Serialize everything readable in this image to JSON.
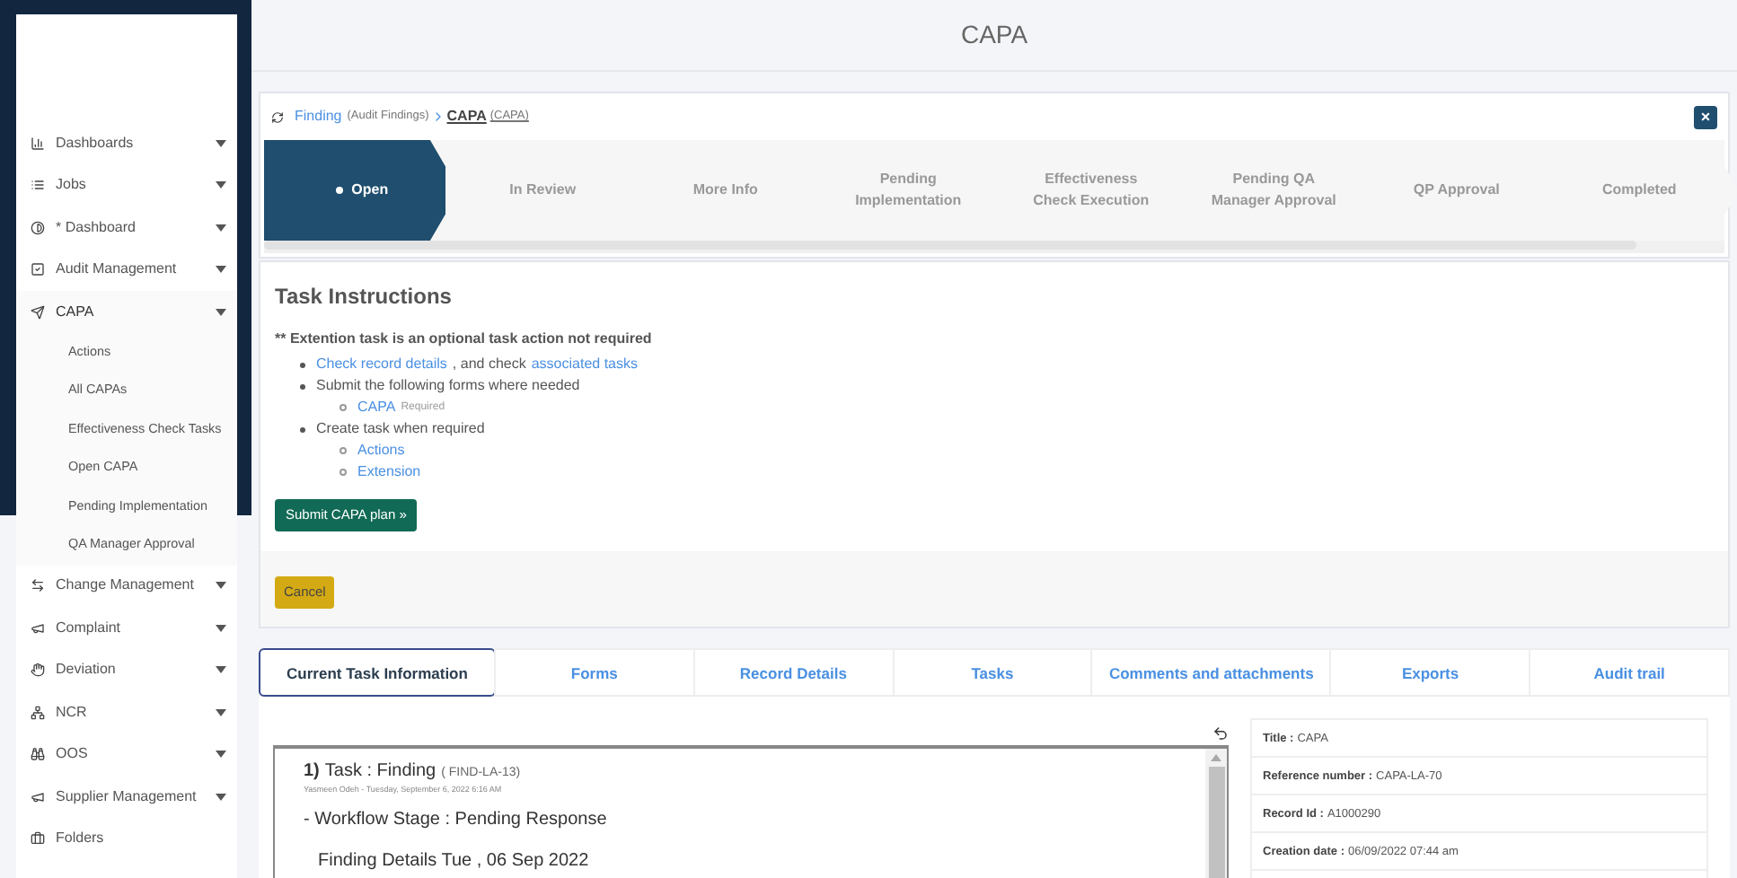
{
  "header": {
    "title": "CAPA"
  },
  "sidebar": {
    "items": [
      {
        "label": "Dashboards",
        "expanded": false,
        "caret": true
      },
      {
        "label": "Jobs",
        "expanded": false,
        "caret": true
      },
      {
        "label": "* Dashboard",
        "expanded": false,
        "caret": true
      },
      {
        "label": "Audit Management",
        "expanded": false,
        "caret": true
      },
      {
        "label": "CAPA",
        "expanded": true,
        "caret": true,
        "children": [
          {
            "label": "Actions"
          },
          {
            "label": "All CAPAs"
          },
          {
            "label": "Effectiveness Check Tasks"
          },
          {
            "label": "Open CAPA"
          },
          {
            "label": "Pending Implementation"
          },
          {
            "label": "QA Manager Approval"
          }
        ]
      },
      {
        "label": "Change Management",
        "expanded": false,
        "caret": true
      },
      {
        "label": "Complaint",
        "expanded": false,
        "caret": true
      },
      {
        "label": "Deviation",
        "expanded": false,
        "caret": true
      },
      {
        "label": "NCR",
        "expanded": false,
        "caret": true
      },
      {
        "label": "OOS",
        "expanded": false,
        "caret": true
      },
      {
        "label": "Supplier Management",
        "expanded": false,
        "caret": true
      },
      {
        "label": "Folders",
        "expanded": false,
        "caret": false
      }
    ]
  },
  "breadcrumb": {
    "parent": "Finding",
    "parent_note": "(Audit Findings)",
    "current": "CAPA",
    "current_note": "(CAPA)"
  },
  "close_label": "×",
  "steps": [
    {
      "label": "Open",
      "selected": true
    },
    {
      "label": "In Review",
      "selected": false
    },
    {
      "label": "More Info",
      "selected": false
    },
    {
      "label": "Pending Implementation",
      "selected": false
    },
    {
      "label": "Effectiveness Check Execution",
      "selected": false
    },
    {
      "label": "Pending QA Manager Approval",
      "selected": false
    },
    {
      "label": "QP Approval",
      "selected": false
    },
    {
      "label": "Completed",
      "selected": false
    }
  ],
  "instructions": {
    "title": "Task Instructions",
    "note": "** Extention task is an optional task action not required",
    "items": [
      {
        "parts": [
          {
            "text": "Check record details",
            "link": true
          },
          {
            "text": ", and check",
            "link": false
          },
          {
            "text": "associated tasks",
            "link": true
          }
        ]
      },
      {
        "parts": [
          {
            "text": "Submit the following forms where needed",
            "link": false
          }
        ],
        "children": [
          {
            "text": "CAPA",
            "link": true,
            "note": "Required"
          }
        ]
      },
      {
        "parts": [
          {
            "text": "Create task when required",
            "link": false
          }
        ],
        "children": [
          {
            "text": "Actions",
            "link": true
          },
          {
            "text": "Extension",
            "link": true
          }
        ]
      }
    ],
    "submit_button": "Submit CAPA plan »",
    "cancel_button": "Cancel"
  },
  "tabs": [
    {
      "label": "Current Task Information",
      "selected": true
    },
    {
      "label": "Forms",
      "selected": false
    },
    {
      "label": "Record Details",
      "selected": false
    },
    {
      "label": "Tasks",
      "selected": false
    },
    {
      "label": "Comments and attachments",
      "selected": false
    },
    {
      "label": "Exports",
      "selected": false
    },
    {
      "label": "Audit trail",
      "selected": false
    }
  ],
  "task": {
    "number": "1)",
    "title": "Task : Finding",
    "code": "( FIND-LA-13)",
    "meta": "Yasmeen Odeh - Tuesday, September 6, 2022 6:16 AM",
    "stage": "- Workflow Stage : Pending Response",
    "details": "Finding Details Tue , 06 Sep 2022"
  },
  "record": [
    {
      "label": "Title :",
      "value": "CAPA"
    },
    {
      "label": "Reference number :",
      "value": "CAPA-LA-70"
    },
    {
      "label": "Record Id :",
      "value": "A1000290"
    },
    {
      "label": "Creation date :",
      "value": "06/09/2022 07:44 am"
    }
  ]
}
